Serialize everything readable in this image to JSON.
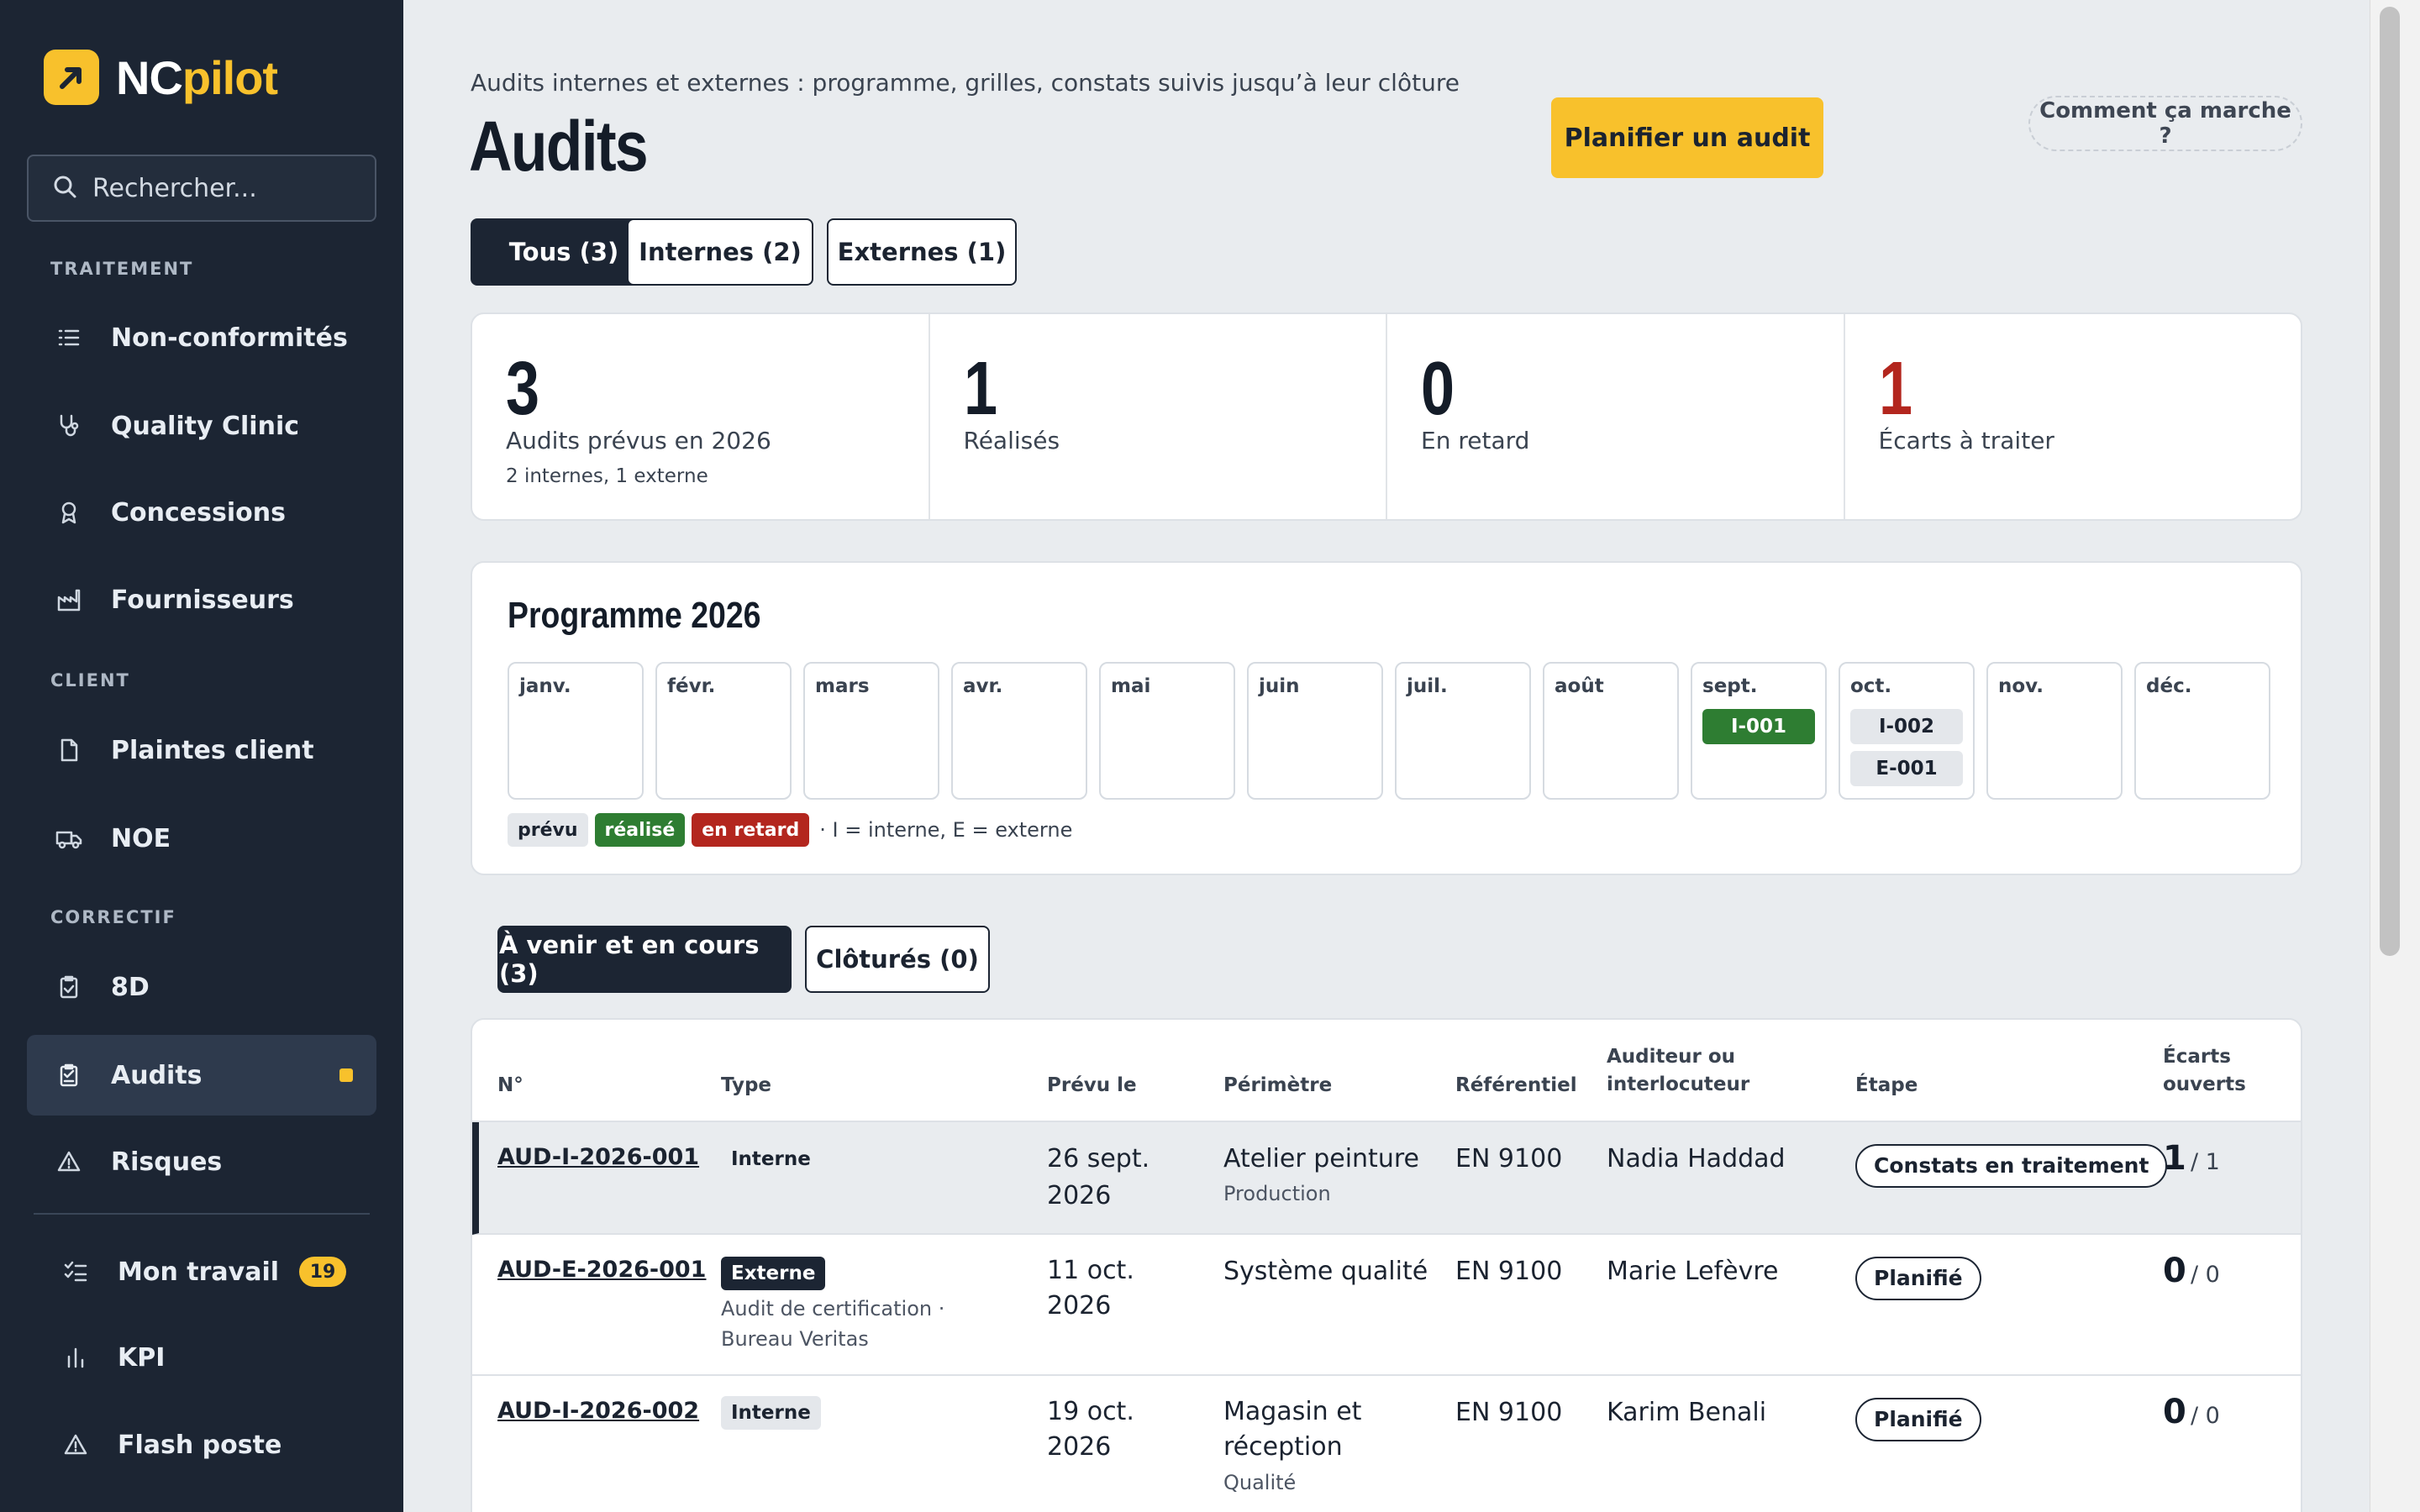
{
  "brand": {
    "name_part1": "NC",
    "name_part2": "pilot"
  },
  "search": {
    "placeholder": "Rechercher..."
  },
  "sidebar": {
    "sections": [
      "TRAITEMENT",
      "CLIENT",
      "CORRECTIF"
    ],
    "items": [
      {
        "label": "Non-conformités",
        "icon": "list-icon"
      },
      {
        "label": "Quality Clinic",
        "icon": "stethoscope-icon"
      },
      {
        "label": "Concessions",
        "icon": "award-icon"
      },
      {
        "label": "Fournisseurs",
        "icon": "factory-icon"
      },
      {
        "label": "Plaintes client",
        "icon": "document-icon"
      },
      {
        "label": "NOE",
        "icon": "truck-icon"
      },
      {
        "label": "8D",
        "icon": "clipboard-check-icon"
      },
      {
        "label": "Audits",
        "icon": "clipboard-list-icon",
        "active": true
      },
      {
        "label": "Risques",
        "icon": "warning-icon"
      },
      {
        "label": "Mon travail",
        "icon": "checklist-icon",
        "badge": "19"
      },
      {
        "label": "KPI",
        "icon": "bar-chart-icon"
      },
      {
        "label": "Flash poste",
        "icon": "warning-icon"
      }
    ]
  },
  "header": {
    "subtitle": "Audits internes et externes : programme, grilles, constats suivis jusqu’à leur clôture",
    "title": "Audits",
    "primary_button": "Planifier un audit",
    "help_button": "Comment ça marche ?"
  },
  "filter_tabs": [
    "Tous (3)",
    "Internes (2)",
    "Externes (1)"
  ],
  "kpis": [
    {
      "value": "3",
      "label": "Audits prévus en 2026",
      "sub": "2 internes, 1 externe"
    },
    {
      "value": "1",
      "label": "Réalisés",
      "sub": ""
    },
    {
      "value": "0",
      "label": "En retard",
      "sub": ""
    },
    {
      "value": "1",
      "label": "Écarts à traiter",
      "sub": ""
    }
  ],
  "programme": {
    "title": "Programme 2026",
    "months": [
      "janv.",
      "févr.",
      "mars",
      "avr.",
      "mai",
      "juin",
      "juil.",
      "août",
      "sept.",
      "oct.",
      "nov.",
      "déc."
    ],
    "chips": {
      "sept.": [
        {
          "label": "I-001",
          "status": "realise"
        }
      ],
      "oct.": [
        {
          "label": "I-002",
          "status": "prevu"
        },
        {
          "label": "E-001",
          "status": "prevu"
        }
      ]
    },
    "legend": {
      "prevu": "prévu",
      "realise": "réalisé",
      "retard": "en retard",
      "note": "· I = interne, E = externe"
    }
  },
  "list_tabs": [
    "À venir et en cours (3)",
    "Clôturés (0)"
  ],
  "table": {
    "headers": {
      "num": "N°",
      "type": "Type",
      "date": "Prévu le",
      "perimetre": "Périmètre",
      "referentiel": "Référentiel",
      "auditeur_1": "Auditeur ou",
      "auditeur_2": "interlocuteur",
      "etape": "Étape",
      "ecarts_1": "Écarts",
      "ecarts_2": "ouverts"
    },
    "rows": [
      {
        "id": "AUD-I-2026-001",
        "type": "Interne",
        "type_kind": "interne",
        "type_sub_1": "",
        "type_sub_2": "",
        "date_1": "26 sept.",
        "date_2": "2026",
        "perimetre_1": "Atelier peinture",
        "perimetre_2": "",
        "perimetre_sub": "Production",
        "referentiel": "EN 9100",
        "auditeur": "Nadia Haddad",
        "etape": "Constats en traitement",
        "ecarts_open": "1",
        "ecarts_total": "/ 1"
      },
      {
        "id": "AUD-E-2026-001",
        "type": "Externe",
        "type_kind": "externe",
        "type_sub_1": "Audit de certification ·",
        "type_sub_2": "Bureau Veritas",
        "date_1": "11 oct.",
        "date_2": "2026",
        "perimetre_1": "Système qualité",
        "perimetre_2": "",
        "perimetre_sub": "",
        "referentiel": "EN 9100",
        "auditeur": "Marie Lefèvre",
        "etape": "Planifié",
        "ecarts_open": "0",
        "ecarts_total": "/ 0"
      },
      {
        "id": "AUD-I-2026-002",
        "type": "Interne",
        "type_kind": "interne",
        "type_sub_1": "",
        "type_sub_2": "",
        "date_1": "19 oct.",
        "date_2": "2026",
        "perimetre_1": "Magasin et",
        "perimetre_2": "réception",
        "perimetre_sub": "Qualité",
        "referentiel": "EN 9100",
        "auditeur": "Karim Benali",
        "etape": "Planifié",
        "ecarts_open": "0",
        "ecarts_total": "/ 0"
      }
    ]
  },
  "colors": {
    "sidebar_bg": "#1c2533",
    "accent": "#f8c12c",
    "success": "#2e7d32",
    "danger": "#b3261e"
  }
}
